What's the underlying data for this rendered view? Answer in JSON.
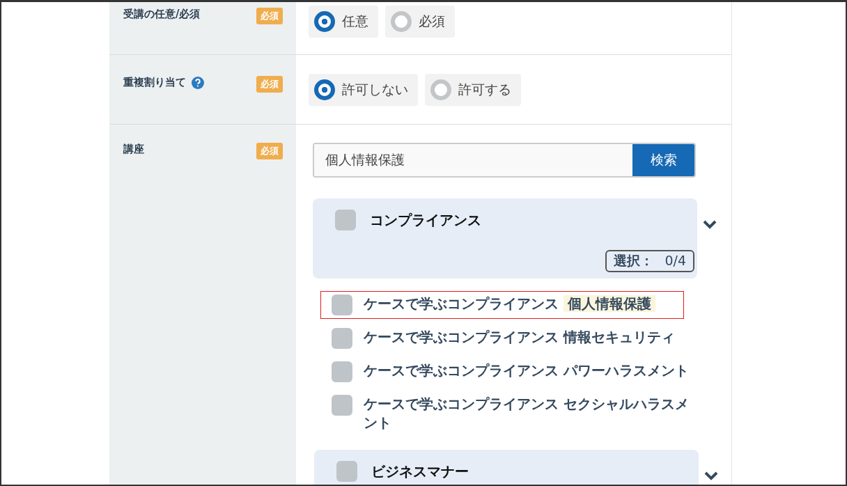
{
  "rows": [
    {
      "kind": "radio",
      "label": "受講の任意/必須",
      "help": false,
      "badge": "必須",
      "options": [
        {
          "label": "任意",
          "selected": true
        },
        {
          "label": "必須",
          "selected": false
        }
      ]
    },
    {
      "kind": "radio",
      "label": "重複割り当て",
      "help": true,
      "badge": "必須",
      "options": [
        {
          "label": "許可しない",
          "selected": true
        },
        {
          "label": "許可する",
          "selected": false
        }
      ]
    },
    {
      "kind": "courses",
      "label": "講座",
      "help": false,
      "badge": "必須",
      "search": {
        "value": "個人情報保護",
        "button": "検索"
      },
      "groups": [
        {
          "name": "コンプライアンス",
          "checked": false,
          "count_label": "選択：",
          "count": "0/4",
          "items": [
            {
              "text": "ケースで学ぶコンプライアンス **個人情報保護**",
              "checked": false,
              "outlined": true
            },
            {
              "text": "ケースで学ぶコンプライアンス 情報セキュリティ",
              "checked": false,
              "outlined": false
            },
            {
              "text": "ケースで学ぶコンプライアンス パワーハラスメント",
              "checked": false,
              "outlined": false
            },
            {
              "text": "ケースで学ぶコンプライアンス セクシャルハラスメント",
              "checked": false,
              "outlined": false
            }
          ]
        },
        {
          "name": "ビジネスマナー",
          "checked": false
        }
      ]
    }
  ]
}
